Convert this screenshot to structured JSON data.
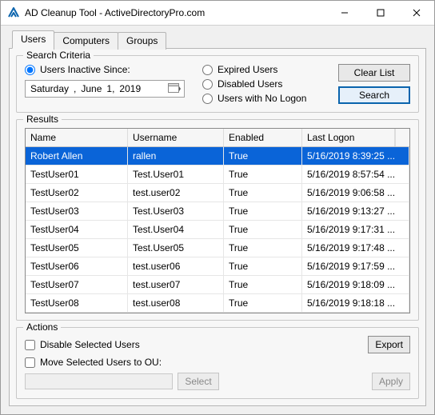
{
  "window": {
    "title": "AD Cleanup Tool - ActiveDirectoryPro.com"
  },
  "tabs": {
    "users": "Users",
    "computers": "Computers",
    "groups": "Groups",
    "active": "users"
  },
  "search": {
    "legend": "Search Criteria",
    "inactive_label": "Users Inactive Since:",
    "date": {
      "dow": "Saturday",
      "sep": ",",
      "month": "June",
      "day": "1,",
      "year": "2019"
    },
    "expired_label": "Expired Users",
    "disabled_label": "Disabled Users",
    "no_logon_label": "Users with No Logon",
    "clear_btn": "Clear List",
    "search_btn": "Search"
  },
  "results": {
    "legend": "Results",
    "columns": {
      "name": "Name",
      "username": "Username",
      "enabled": "Enabled",
      "last_logon": "Last Logon"
    },
    "rows": [
      {
        "name": "Robert Allen",
        "username": "rallen",
        "enabled": "True",
        "last_logon": "5/16/2019 8:39:25 ...",
        "selected": true
      },
      {
        "name": "TestUser01",
        "username": "Test.User01",
        "enabled": "True",
        "last_logon": "5/16/2019 8:57:54 ..."
      },
      {
        "name": "TestUser02",
        "username": "test.user02",
        "enabled": "True",
        "last_logon": "5/16/2019 9:06:58 ..."
      },
      {
        "name": "TestUser03",
        "username": "Test.User03",
        "enabled": "True",
        "last_logon": "5/16/2019 9:13:27 ..."
      },
      {
        "name": "TestUser04",
        "username": "Test.User04",
        "enabled": "True",
        "last_logon": "5/16/2019 9:17:31 ..."
      },
      {
        "name": "TestUser05",
        "username": "Test.User05",
        "enabled": "True",
        "last_logon": "5/16/2019 9:17:48 ..."
      },
      {
        "name": "TestUser06",
        "username": "test.user06",
        "enabled": "True",
        "last_logon": "5/16/2019 9:17:59 ..."
      },
      {
        "name": "TestUser07",
        "username": "test.user07",
        "enabled": "True",
        "last_logon": "5/16/2019 9:18:09 ..."
      },
      {
        "name": "TestUser08",
        "username": "test.user08",
        "enabled": "True",
        "last_logon": "5/16/2019 9:18:18 ..."
      }
    ]
  },
  "actions": {
    "legend": "Actions",
    "disable_label": "Disable Selected Users",
    "move_label": "Move Selected Users to OU:",
    "export_btn": "Export",
    "select_btn": "Select",
    "apply_btn": "Apply"
  }
}
